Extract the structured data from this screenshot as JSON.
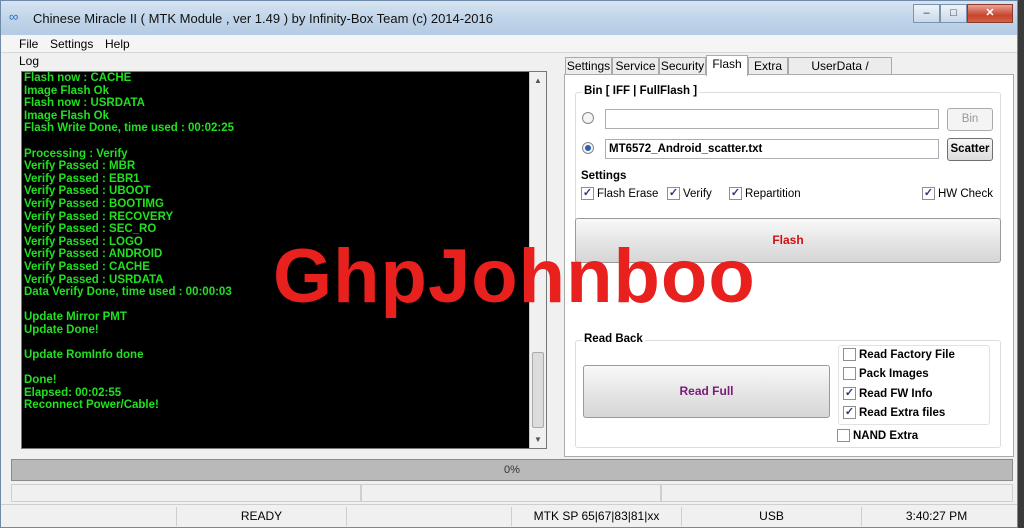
{
  "window": {
    "title": "Chinese Miracle II ( MTK Module , ver 1.49 ) by Infinity-Box Team (c) 2014-2016",
    "minimize": "–",
    "maximize": "□",
    "close": "✕"
  },
  "menu": [
    "File",
    "Settings",
    "Help"
  ],
  "log": {
    "label": "Log",
    "lines": [
      "Flash now : CACHE",
      "Image Flash Ok",
      "Flash now : USRDATA",
      "Image Flash Ok",
      "Flash Write Done, time used : 00:02:25",
      "",
      "Processing : Verify",
      "Verify Passed : MBR",
      "Verify Passed : EBR1",
      "Verify Passed : UBOOT",
      "Verify Passed : BOOTIMG",
      "Verify Passed : RECOVERY",
      "Verify Passed : SEC_RO",
      "Verify Passed : LOGO",
      "Verify Passed : ANDROID",
      "Verify Passed : CACHE",
      "Verify Passed : USRDATA",
      "Data Verify Done, time used : 00:00:03",
      "",
      "Update Mirror PMT",
      "Update Done!",
      "",
      "Update RomInfo done",
      "",
      "Done!",
      "Elapsed: 00:02:55",
      "Reconnect Power/Cable!"
    ]
  },
  "tabs": [
    "Settings",
    "Service",
    "Security",
    "Flash",
    "Extra",
    "UserData / Forensic"
  ],
  "active_tab": "Flash",
  "flash": {
    "bin_group_title": "Bin  [ IFF | FullFlash ]",
    "bin_value": "",
    "bin_button": "Bin",
    "scatter_value": "MT6572_Android_scatter.txt",
    "scatter_button": "Scatter",
    "settings_title": "Settings",
    "flash_erase": "Flash Erase",
    "verify": "Verify",
    "repartition": "Repartition",
    "hw_check": "HW Check",
    "flash_button": "Flash",
    "flash_button_color": "#cc1111",
    "readback_title": "Read Back",
    "read_full_button": "Read Full",
    "read_full_color": "#7a1a7a",
    "read_factory_file": "Read Factory File",
    "pack_images": "Pack Images",
    "read_fw_info": "Read FW Info",
    "read_extra_files": "Read Extra files",
    "nand_extra": "NAND Extra"
  },
  "watermark": "GhpJohnboo",
  "progress": {
    "text": "0%",
    "value": 0
  },
  "status": {
    "state": "READY",
    "chip": "MTK SP 65|67|83|81|xx",
    "port": "USB",
    "time": "3:40:27 PM"
  }
}
